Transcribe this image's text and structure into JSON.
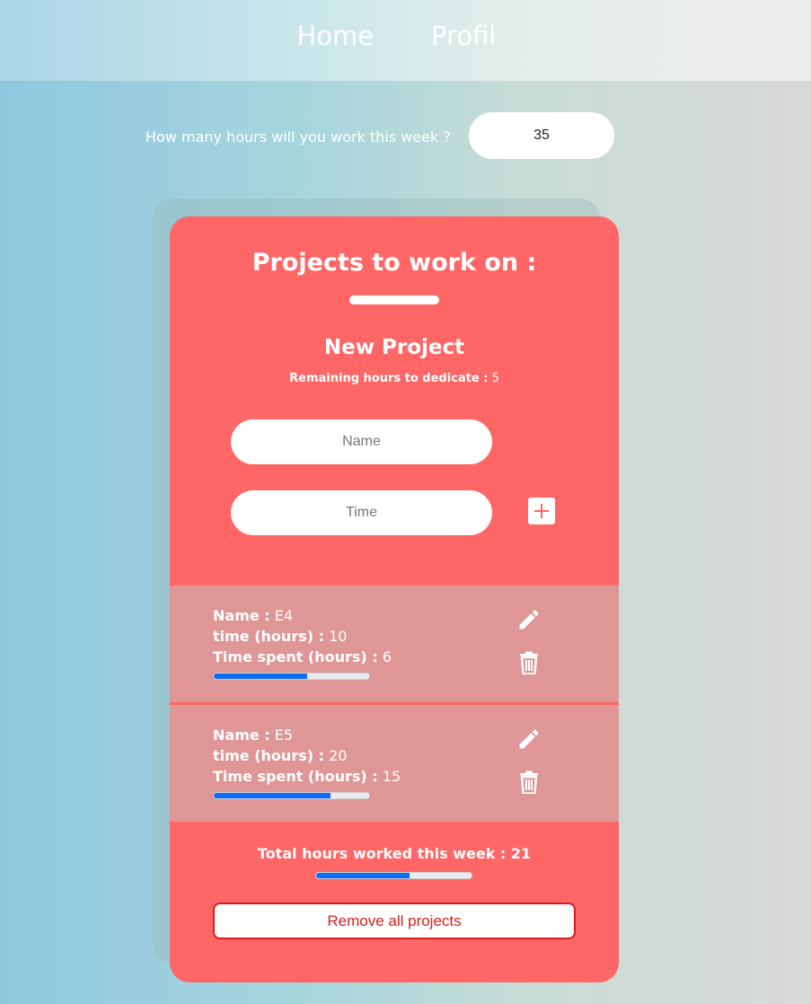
{
  "nav": {
    "links": [
      "Home",
      "Profil"
    ]
  },
  "hours": {
    "label": "How many hours will you work this week ?",
    "value": "35"
  },
  "card": {
    "title": "Projects to work on :",
    "new_project_title": "New Project",
    "remaining_label": "Remaining hours to dedicate :",
    "remaining_value": "5",
    "name_placeholder": "Name",
    "time_placeholder": "Time",
    "add_icon": "plus-icon"
  },
  "labels": {
    "name": "Name :",
    "time": "time (hours) :",
    "time_spent": "Time spent (hours) :"
  },
  "projects": [
    {
      "name": "E4",
      "time": "10",
      "time_spent": "6",
      "progress": 0.6
    },
    {
      "name": "E5",
      "time": "20",
      "time_spent": "15",
      "progress": 0.75
    }
  ],
  "total": {
    "label": "Total hours worked this week :",
    "value": "21",
    "progress": 0.6
  },
  "remove_all_label": "Remove all projects",
  "colors": {
    "card": "#ff6666",
    "project_bg": "#de9696",
    "progress": "#0d6efd",
    "remove_border": "#dc1c1c"
  }
}
